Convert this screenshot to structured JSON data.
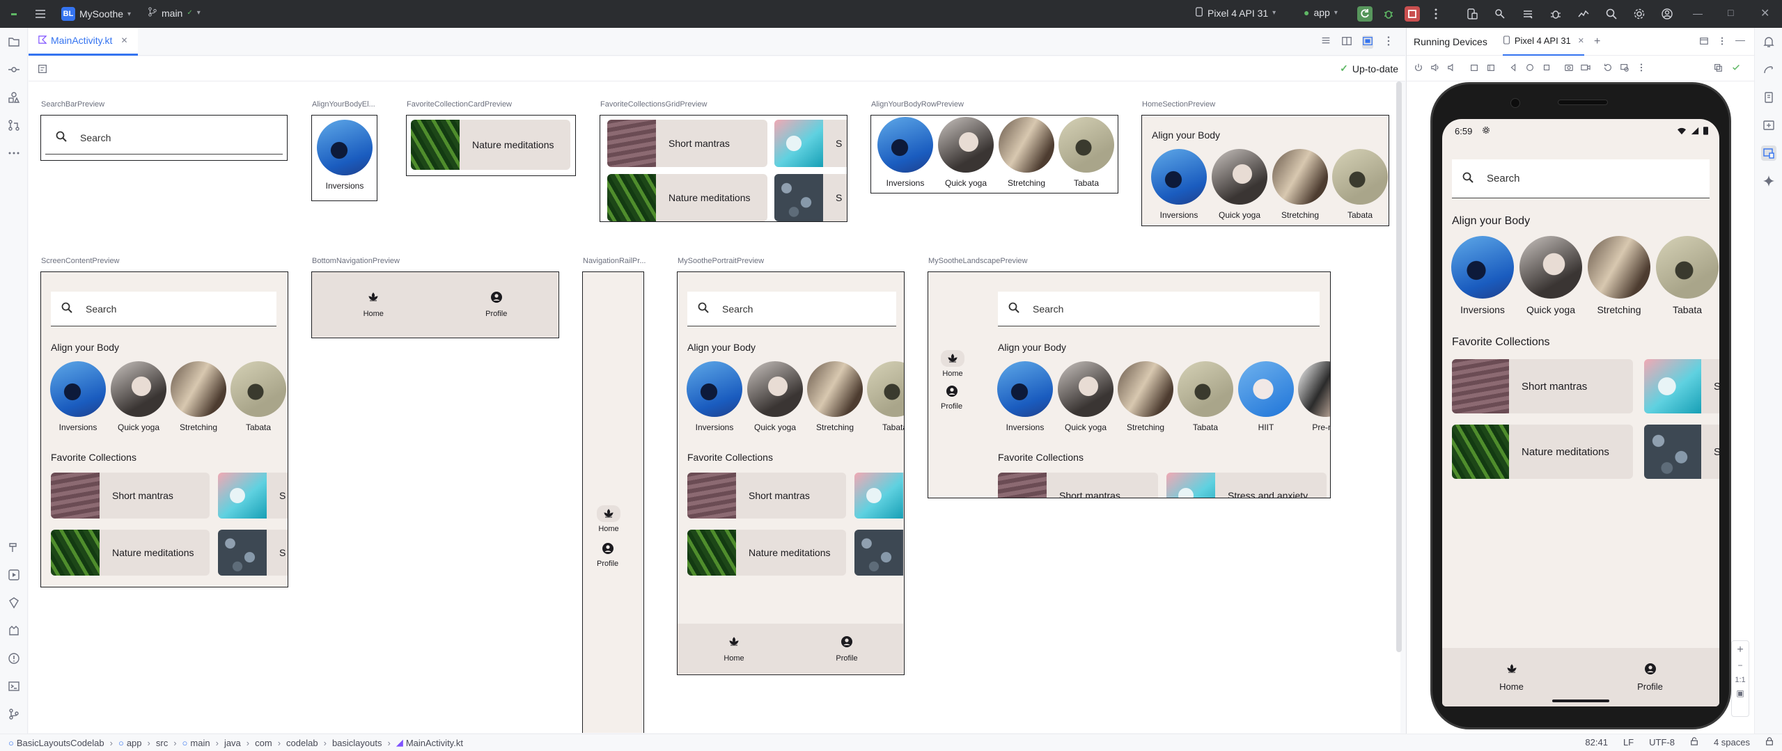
{
  "titlebar": {
    "project_badge": "BL",
    "project_name": "MySoothe",
    "branch": "main",
    "device": "Pixel 4 API 31",
    "run_config": "app"
  },
  "editor": {
    "tab_label": "MainActivity.kt",
    "status": "Up-to-date"
  },
  "previews": {
    "search_bar": "SearchBarPreview",
    "align_element": "AlignYourBodyEl...",
    "fav_card": "FavoriteCollectionCardPreview",
    "fav_grid": "FavoriteCollectionsGridPreview",
    "align_row": "AlignYourBodyRowPreview",
    "home_section": "HomeSectionPreview",
    "screen_content": "ScreenContentPreview",
    "bottom_nav": "BottomNavigationPreview",
    "nav_rail": "NavigationRailPr...",
    "portrait": "MySoothePortraitPreview",
    "landscape": "MySootheLandscapePreview"
  },
  "content": {
    "search_placeholder": "Search",
    "align_title": "Align your Body",
    "favorites_title": "Favorite Collections",
    "align_items": [
      "Inversions",
      "Quick yoga",
      "Stretching",
      "Tabata",
      "HIIT",
      "Pre-nat"
    ],
    "collections": [
      "Short mantras",
      "Stress and anxiety",
      "Nature meditations",
      "S"
    ],
    "stress_partial": "S",
    "nav_home": "Home",
    "nav_profile": "Profile"
  },
  "running_devices": {
    "title": "Running Devices",
    "device_tab": "Pixel 4 API 31",
    "phone_time": "6:59",
    "zoom_label": "1:1"
  },
  "statusbar": {
    "breadcrumb": [
      "BasicLayoutsCodelab",
      "app",
      "src",
      "main",
      "java",
      "com",
      "codelab",
      "basiclayouts",
      "MainActivity.kt"
    ],
    "position": "82:41",
    "line_sep": "LF",
    "encoding": "UTF-8",
    "indent": "4 spaces"
  },
  "colors": {
    "accent": "#3574f0",
    "surface": "#f4efeb",
    "card": "#e7e0dc",
    "titlebar": "#2b2d30"
  }
}
